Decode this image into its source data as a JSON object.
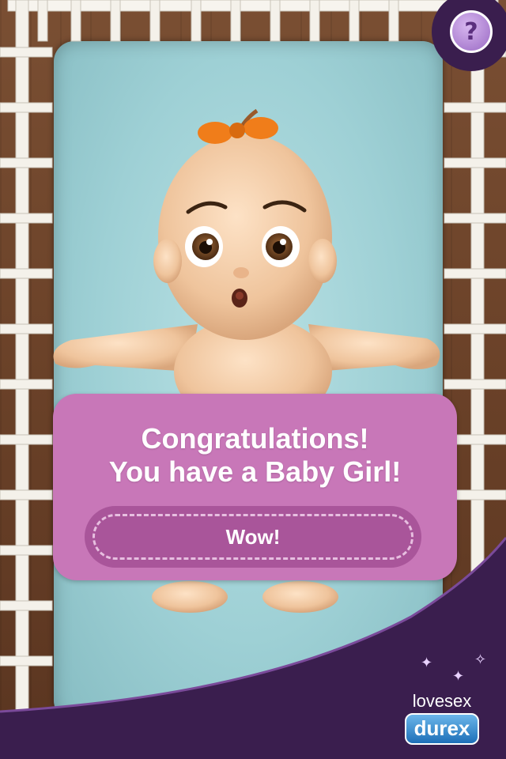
{
  "dialog": {
    "title_line1": "Congratulations!",
    "title_line2": "You have a Baby Girl!",
    "button_label": "Wow!"
  },
  "help": {
    "label": "?"
  },
  "brand": {
    "tagline": "lovesex",
    "logo_text": "durex"
  },
  "colors": {
    "dialog_bg": "#c877b8",
    "button_bg": "#a9559a",
    "swoosh": "#3a1e4e",
    "mattress": "#9ed0d5",
    "bow": "#f07d1a"
  },
  "icons": {
    "help": "question-mark-icon"
  }
}
